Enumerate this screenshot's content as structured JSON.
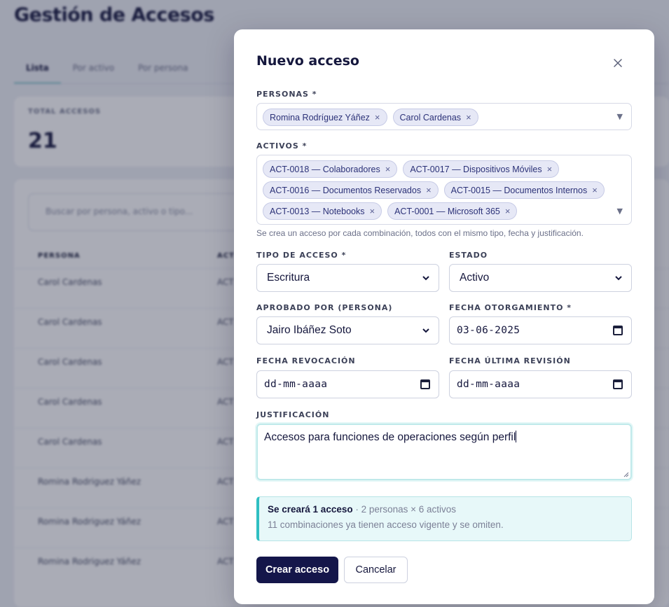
{
  "background": {
    "page_title": "Gestión de Accesos",
    "tabs": [
      {
        "label": "Lista"
      },
      {
        "label": "Por activo"
      },
      {
        "label": "Por persona"
      }
    ],
    "summary": {
      "label": "TOTAL ACCESOS",
      "value": "21"
    },
    "search_placeholder": "Buscar por persona, activo o tipo...",
    "table": {
      "headers": [
        "PERSONA",
        "ACT"
      ],
      "rows": [
        {
          "persona": "Carol Cardenas",
          "activo": "ACT"
        },
        {
          "persona": "Carol Cardenas",
          "activo": "ACT"
        },
        {
          "persona": "Carol Cardenas",
          "activo": "ACT"
        },
        {
          "persona": "Carol Cardenas",
          "activo": "ACT"
        },
        {
          "persona": "Carol Cardenas",
          "activo": "ACT"
        },
        {
          "persona": "Romina Rodriguez Yáñez",
          "activo": "ACT"
        },
        {
          "persona": "Romina Rodriguez Yáñez",
          "activo": "ACT"
        },
        {
          "persona": "Romina Rodriguez Yáñez",
          "activo": "ACT"
        }
      ]
    }
  },
  "modal": {
    "title": "Nuevo acceso",
    "close_icon": "close-icon",
    "personas": {
      "label": "PERSONAS *",
      "selected": [
        "Romina Rodríguez Yáñez",
        "Carol Cardenas"
      ]
    },
    "activos": {
      "label": "ACTIVOS *",
      "selected": [
        "ACT-0018 — Colaboradores",
        "ACT-0017 — Dispositivos Móviles",
        "ACT-0016 — Documentos Reservados",
        "ACT-0015 — Documentos Internos",
        "ACT-0013 — Notebooks",
        "ACT-0001 — Microsoft 365"
      ],
      "hint": "Se crea un acceso por cada combinación, todos con el mismo tipo, fecha y justificación."
    },
    "tipo_acceso": {
      "label": "TIPO DE ACCESO *",
      "value": "Escritura"
    },
    "estado": {
      "label": "ESTADO",
      "value": "Activo"
    },
    "aprobado_por": {
      "label": "APROBADO POR (PERSONA)",
      "value": "Jairo Ibáñez Soto"
    },
    "fecha_otorgamiento": {
      "label": "FECHA OTORGAMIENTO *",
      "value": "03-06-2025"
    },
    "fecha_revocacion": {
      "label": "FECHA REVOCACIÓN",
      "value": "dd-mm-aaaa"
    },
    "fecha_ultima_revision": {
      "label": "FECHA ÚLTIMA REVISIÓN",
      "value": "dd-mm-aaaa"
    },
    "justificacion": {
      "label": "JUSTIFICACIÓN",
      "value": "Accesos para funciones de operaciones según perfil"
    },
    "info": {
      "strong": "Se creará 1 acceso",
      "detail": " · 2 personas × 6 activos",
      "line2": "11 combinaciones ya tienen acceso vigente y se omiten."
    },
    "buttons": {
      "submit": "Crear acceso",
      "cancel": "Cancelar"
    }
  },
  "colors": {
    "primary": "#14164a",
    "accent": "#2fbfc2",
    "chip_bg": "#e6e8f6"
  }
}
